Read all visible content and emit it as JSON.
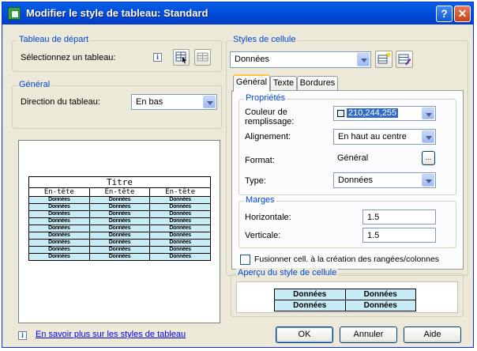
{
  "window": {
    "title": "Modifier le style de tableau: Standard",
    "help_glyph": "?",
    "close_glyph": "✕"
  },
  "left": {
    "start_group": {
      "legend": "Tableau de départ",
      "select_label": "Sélectionnez un tableau:"
    },
    "general_group": {
      "legend": "Général",
      "direction_label": "Direction du tableau:",
      "direction_value": "En bas"
    },
    "preview_table": {
      "title": "Titre",
      "headers": [
        "En-tête",
        "En-tête",
        "En-tête"
      ],
      "rows": [
        [
          "Données",
          "Données",
          "Données"
        ],
        [
          "Données",
          "Données",
          "Données"
        ],
        [
          "Données",
          "Données",
          "Données"
        ],
        [
          "Données",
          "Données",
          "Données"
        ],
        [
          "Données",
          "Données",
          "Données"
        ],
        [
          "Données",
          "Données",
          "Données"
        ],
        [
          "Données",
          "Données",
          "Données"
        ],
        [
          "Données",
          "Données",
          "Données"
        ],
        [
          "Données",
          "Données",
          "Données"
        ]
      ]
    }
  },
  "right": {
    "cell_styles": {
      "legend": "Styles de cellule",
      "selected": "Données"
    },
    "tabs": [
      {
        "label": "Général",
        "active": true
      },
      {
        "label": "Texte",
        "active": false
      },
      {
        "label": "Bordures",
        "active": false
      }
    ],
    "properties": {
      "legend": "Propriétés",
      "fill_color_label": "Couleur de remplissage:",
      "fill_color_value": "210,244,255",
      "fill_color_hex": "#d2f4ff",
      "alignment_label": "Alignement:",
      "alignment_value": "En haut au centre",
      "format_label": "Format:",
      "format_value": "Général",
      "format_button": "...",
      "type_label": "Type:",
      "type_value": "Données"
    },
    "margins": {
      "legend": "Marges",
      "horizontal_label": "Horizontale:",
      "horizontal_value": "1.5",
      "vertical_label": "Verticale:",
      "vertical_value": "1.5"
    },
    "merge_checkbox_label": "Fusionner cell. à la création des rangées/colonnes",
    "merge_checked": false,
    "cell_preview": {
      "legend": "Aperçu du style de cellule",
      "rows": [
        [
          "Données",
          "Données"
        ],
        [
          "Données",
          "Données"
        ]
      ]
    }
  },
  "footer": {
    "info_glyph": "i",
    "link": "En savoir plus sur les styles de tableau",
    "ok": "OK",
    "cancel": "Annuler",
    "help": "Aide"
  },
  "colors": {
    "title_bar": "#0058e0",
    "dialog_bg": "#ece9d8",
    "legend_text": "#0046d5",
    "data_cell_fill": "#c8ecf5",
    "selection": "#316ac5"
  }
}
